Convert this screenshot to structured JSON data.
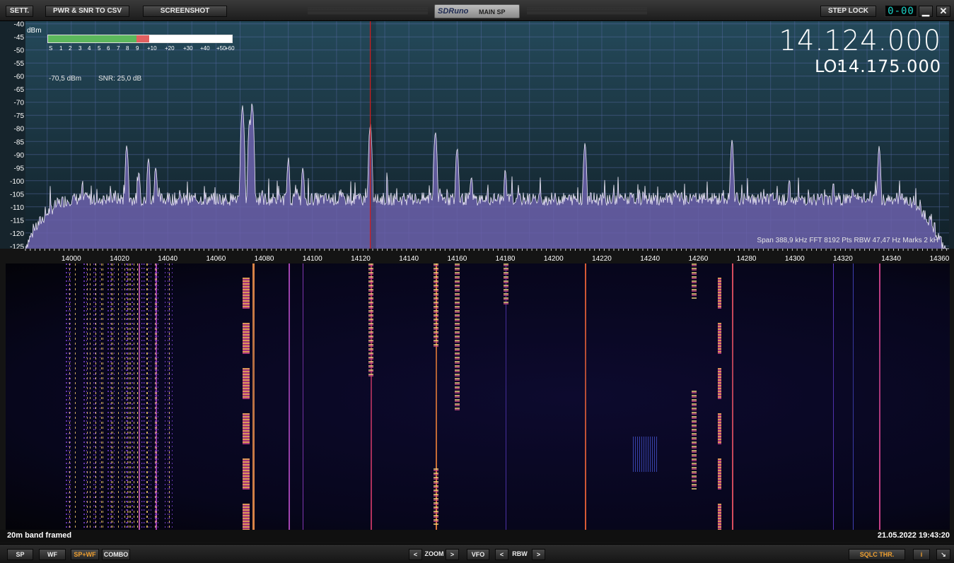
{
  "toolbar": {
    "sett_label": "SETT.",
    "csv_label": "PWR & SNR TO CSV",
    "screenshot_label": "SCREENSHOT",
    "brand_logo": "SDRuno",
    "brand_sub": "MAIN SP",
    "step_lock_label": "STEP LOCK",
    "counter": "0-00",
    "minimize_glyph": "▁",
    "close_glyph": "✕"
  },
  "spectrum": {
    "unit": "dBm",
    "y_ticks": [
      "-40",
      "-45",
      "-50",
      "-55",
      "-60",
      "-65",
      "-70",
      "-75",
      "-80",
      "-85",
      "-90",
      "-95",
      "-100",
      "-105",
      "-110",
      "-115",
      "-120",
      "-125"
    ],
    "x_ticks": [
      "14000",
      "14020",
      "14040",
      "14060",
      "14080",
      "14100",
      "14120",
      "14140",
      "14160",
      "14180",
      "14200",
      "14220",
      "14240",
      "14260",
      "14280",
      "14300",
      "14320",
      "14340",
      "14360"
    ],
    "smeter_scale": [
      "S",
      "1",
      "2",
      "3",
      "4",
      "5",
      "6",
      "7",
      "8",
      "9",
      "+10",
      "+20",
      "+30",
      "+40",
      "+50",
      "+60"
    ],
    "smeter_level_s": 9,
    "power_readout": "-70,5 dBm",
    "snr_readout": "SNR: 25,0 dB",
    "frequency": "14.124.000",
    "lo_label": "LO:",
    "lo_frequency": "14.175.000",
    "span_info": "Span 388,9 kHz   FFT 8192 Pts   RBW 47,47 Hz   Marks 2 kH",
    "vfo_frequency_khz": 14124
  },
  "chart_data": {
    "type": "line",
    "xlabel": "",
    "ylabel": "dBm",
    "xlim": [
      13981,
      14364
    ],
    "ylim": [
      -126,
      -39
    ],
    "grid": true,
    "noise_floor": -107,
    "peaks": [
      {
        "x": 14023,
        "y": -86
      },
      {
        "x": 14028,
        "y": -96
      },
      {
        "x": 14032,
        "y": -91
      },
      {
        "x": 14035,
        "y": -94
      },
      {
        "x": 14071,
        "y": -71
      },
      {
        "x": 14074,
        "y": -76
      },
      {
        "x": 14075,
        "y": -70
      },
      {
        "x": 14090,
        "y": -91
      },
      {
        "x": 14096,
        "y": -94
      },
      {
        "x": 14124,
        "y": -78
      },
      {
        "x": 14151,
        "y": -81
      },
      {
        "x": 14160,
        "y": -87
      },
      {
        "x": 14166,
        "y": -98
      },
      {
        "x": 14180,
        "y": -95
      },
      {
        "x": 14213,
        "y": -85
      },
      {
        "x": 14258,
        "y": -104
      },
      {
        "x": 14274,
        "y": -84
      },
      {
        "x": 14316,
        "y": -100
      },
      {
        "x": 14324,
        "y": -102
      },
      {
        "x": 14335,
        "y": -86
      }
    ]
  },
  "status": {
    "text": "20m band framed",
    "datetime": "21.05.2022 19:43:20"
  },
  "bottom": {
    "sp": "SP",
    "wf": "WF",
    "spwf": "SP+WF",
    "combo": "COMBO",
    "zoom": "ZOOM",
    "vfo": "VFO",
    "rbw": "RBW",
    "left": "<",
    "right": ">",
    "sqlc": "SQLC THR.",
    "info": "i",
    "resize": "↘"
  },
  "colors": {
    "spectrum_fill": "#6b5fa8",
    "spectrum_bg": "#1d3a4a",
    "vfo_line": "#d02020",
    "accent": "#f0a030"
  }
}
